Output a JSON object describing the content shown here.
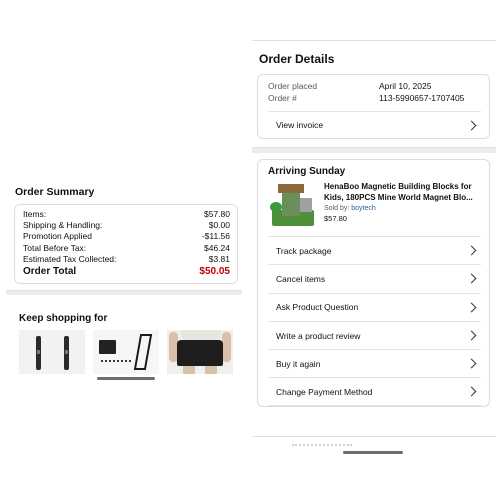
{
  "order_summary": {
    "title": "Order Summary",
    "rows": [
      {
        "label": "Items:",
        "value": "$57.80"
      },
      {
        "label": "Shipping & Handling:",
        "value": "$0.00"
      },
      {
        "label": "Promotion Applied",
        "value": "-$11.56"
      },
      {
        "label": "Total Before Tax:",
        "value": "$46.24"
      },
      {
        "label": "Estimated Tax Collected:",
        "value": "$3.81"
      }
    ],
    "total_label": "Order Total",
    "total_value": "$50.05"
  },
  "keep_shopping": {
    "title": "Keep shopping for"
  },
  "order_details": {
    "title": "Order Details",
    "placed_label": "Order placed",
    "placed_value": "April 10, 2025",
    "number_label": "Order #",
    "number_value": "113-5990657-1707405",
    "invoice_label": "View invoice"
  },
  "arriving": {
    "title": "Arriving Sunday",
    "product_name_line1": "HenaBoo Magnetic Building Blocks for",
    "product_name_line2": "Kids, 180PCS Mine World Magnet Blo...",
    "sold_by_label": "Sold by:",
    "seller": "boytech",
    "price": "$57.80",
    "actions": [
      "Track package",
      "Cancel items",
      "Ask Product Question",
      "Write a product review",
      "Buy it again",
      "Change Payment Method"
    ]
  },
  "colors": {
    "total_red": "#c40000",
    "seller_link": "#2162a1",
    "border": "#dcdcdc"
  }
}
